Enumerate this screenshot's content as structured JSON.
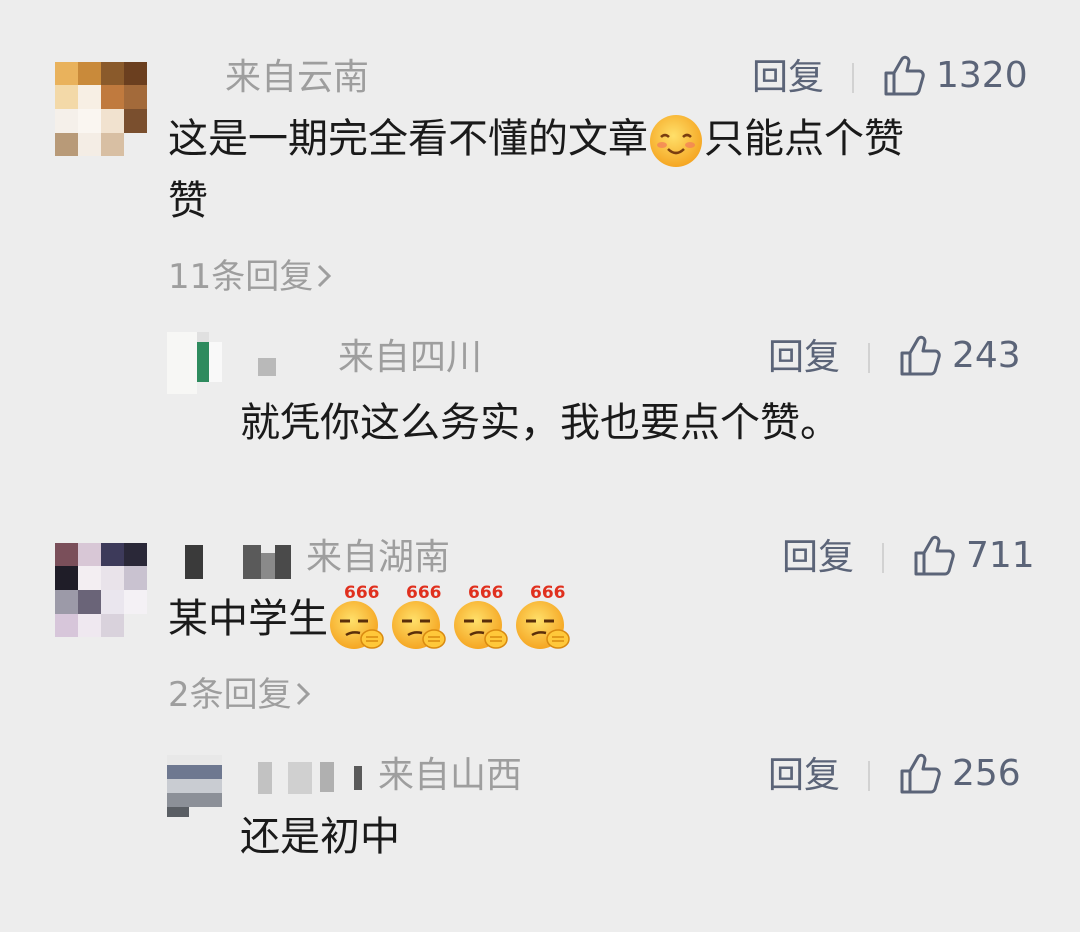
{
  "icons": {
    "like": "thumbs-up-icon",
    "chevron": "chevron-right-icon",
    "emoji_smile": "shy-smile-emoji",
    "emoji_666": "666-emoji"
  },
  "colors": {
    "background": "#ededed",
    "meta_gray": "#9e9e9e",
    "action": "#5b6478"
  },
  "comments": [
    {
      "location": "来自云南",
      "reply_label": "回复",
      "likes": "1320",
      "text_before_emoji": "这是一期完全看不懂的文章",
      "text_after_emoji_line1": "只能点个赞",
      "text_line2": "赞",
      "more_replies": "11条回复",
      "replies": [
        {
          "location": "来自四川",
          "reply_label": "回复",
          "likes": "243",
          "text": "就凭你这么务实，我也要点个赞。"
        }
      ]
    },
    {
      "location": "来自湖南",
      "reply_label": "回复",
      "likes": "711",
      "text_before_emoji": "某中学生",
      "emoji_caption": "666",
      "more_replies": "2条回复",
      "replies": [
        {
          "location": "来自山西",
          "reply_label": "回复",
          "likes": "256",
          "text": "还是初中"
        }
      ]
    }
  ]
}
